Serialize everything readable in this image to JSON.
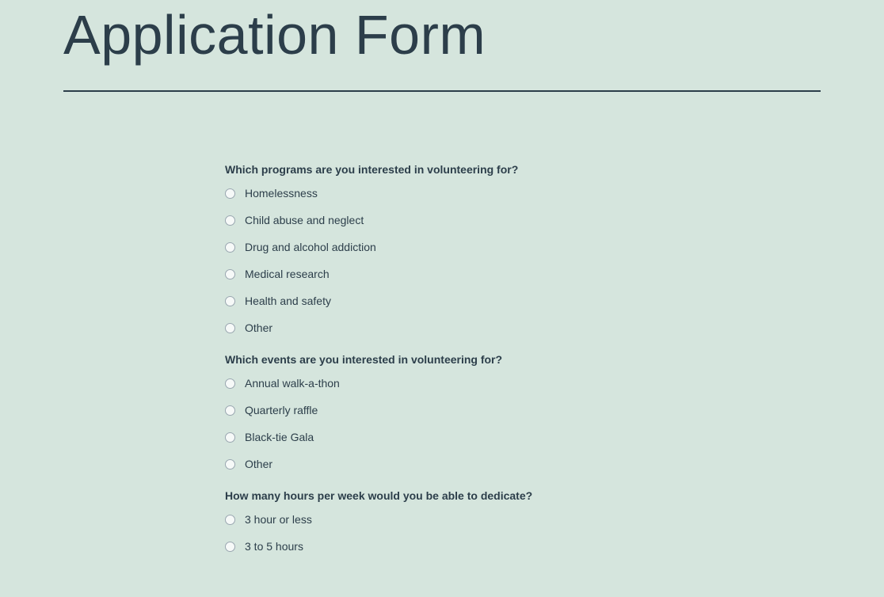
{
  "title": "Application Form",
  "questions": [
    {
      "prompt": "Which programs are you interested in volunteering for?",
      "options": [
        "Homelessness",
        "Child abuse and neglect",
        "Drug and alcohol addiction",
        "Medical research",
        "Health and safety",
        "Other"
      ]
    },
    {
      "prompt": "Which events are you interested in volunteering for?",
      "options": [
        "Annual walk-a-thon",
        "Quarterly raffle",
        "Black-tie Gala",
        "Other"
      ]
    },
    {
      "prompt": "How many hours per week would you be able to dedicate?",
      "options": [
        "3 hour or less",
        "3 to 5 hours"
      ]
    }
  ]
}
